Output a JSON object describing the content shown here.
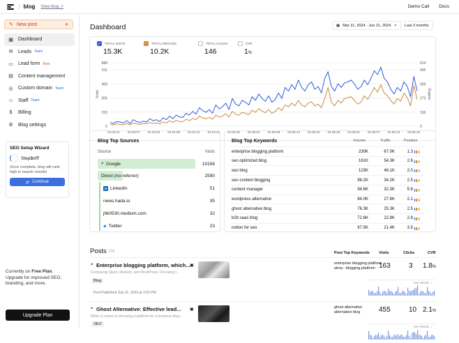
{
  "topbar": {
    "brand": "blog",
    "view_blog": "View blog",
    "demo_call": "Demo Call",
    "docs": "Docs"
  },
  "sidebar": {
    "new_post": "New post",
    "items": [
      {
        "label": "Dashboard",
        "icon": "dashboard-icon",
        "glyph": "▦",
        "tag": "",
        "active": true
      },
      {
        "label": "Leads",
        "icon": "leads-icon",
        "glyph": "✉",
        "tag": "Team"
      },
      {
        "label": "Lead form",
        "icon": "form-icon",
        "glyph": "▭",
        "tag": "New"
      },
      {
        "label": "Content management",
        "icon": "content-icon",
        "glyph": "▤",
        "tag": ""
      },
      {
        "label": "Custom domain",
        "icon": "globe-icon",
        "glyph": "◎",
        "tag": "Team"
      },
      {
        "label": "Staff",
        "icon": "staff-icon",
        "glyph": "☺",
        "tag": "Team"
      },
      {
        "label": "Billing",
        "icon": "billing-icon",
        "glyph": "$",
        "tag": ""
      },
      {
        "label": "Blog settings",
        "icon": "gear-icon",
        "glyph": "⚙",
        "tag": ""
      }
    ],
    "seo_wizard": {
      "title": "SEO Setup Wizard",
      "step_prefix": "Step ",
      "step": "3",
      "of": " of ",
      "total": "7",
      "desc": "Once complete, blog will rank high in search results!",
      "button": "Continue"
    },
    "plan": {
      "prefix": "Currently on ",
      "plan": "Free Plan",
      "suffix": ". Upgrade for improved SEO, branding, and more.",
      "button": "Upgrade Plan"
    }
  },
  "dashboard": {
    "title": "Dashboard",
    "date_range": "Mar 21, 2024 - Jun 21, 2024",
    "period": "Last 3 months",
    "stats": [
      {
        "label": "Total visits",
        "value": "15.3K",
        "color": "#2f5bd6",
        "checked": true
      },
      {
        "label": "Total organic",
        "value": "10.2K",
        "color": "#c98a3d",
        "checked": true
      },
      {
        "label": "Total clicks",
        "value": "146",
        "color": "#ffffff",
        "checked": false
      },
      {
        "label": "CVR",
        "value": "1",
        "unit": "%",
        "checked": false
      }
    ]
  },
  "chart_data": {
    "type": "line",
    "x": [
      "24.03.21",
      "24.03.27",
      "24.04.02",
      "24.04.08",
      "24.04.14",
      "24.04.20",
      "24.04.26",
      "24.05.02",
      "24.05.08",
      "24.05.14",
      "24.05.20",
      "24.05.26",
      "24.06.01",
      "24.06.07",
      "24.06.13",
      "24.06.19"
    ],
    "y_left_ticks": [
      0,
      153,
      306,
      458,
      611
    ],
    "y_left_labels": [
      "0",
      "153",
      "306",
      "458",
      "611"
    ],
    "y_right_labels": [
      "0",
      "136",
      "273",
      "409",
      "545"
    ],
    "y_left_top_label": "688",
    "y_right_top_label": "614",
    "ylim": [
      0,
      688
    ],
    "ylabel_left": "Visits",
    "ylabel_right": "Organic",
    "grid": true,
    "series": [
      {
        "color": "#2f5bd6",
        "values": [
          40,
          30,
          50,
          45,
          35,
          60,
          30,
          70,
          50,
          40,
          55,
          45,
          80,
          60,
          70,
          50,
          90,
          70,
          110,
          80,
          120,
          100,
          95,
          140,
          120,
          160,
          130,
          200,
          170,
          150,
          180,
          140,
          230,
          190,
          210,
          250,
          180,
          300,
          240,
          220,
          280,
          260,
          230,
          320,
          280,
          350,
          300,
          270,
          330,
          260,
          290,
          360,
          300,
          420,
          380,
          450,
          400,
          500,
          420,
          380,
          450,
          480,
          400,
          430,
          360,
          520,
          590,
          430,
          380,
          460,
          420,
          470,
          480,
          500,
          460,
          400,
          430,
          500,
          450,
          520,
          600,
          560,
          640,
          520,
          480,
          400,
          350,
          420,
          380,
          480,
          430,
          320,
          540,
          380
        ]
      },
      {
        "color": "#c98a3d",
        "values": [
          20,
          15,
          25,
          20,
          15,
          30,
          15,
          35,
          25,
          20,
          30,
          25,
          40,
          30,
          35,
          25,
          45,
          35,
          60,
          40,
          65,
          50,
          50,
          75,
          60,
          85,
          70,
          110,
          90,
          80,
          95,
          75,
          120,
          100,
          110,
          135,
          100,
          160,
          130,
          120,
          150,
          140,
          125,
          175,
          150,
          190,
          165,
          145,
          180,
          140,
          160,
          200,
          170,
          230,
          210,
          250,
          220,
          280,
          230,
          210,
          250,
          265,
          220,
          240,
          200,
          300,
          420,
          260,
          220,
          280,
          250,
          300,
          310,
          320,
          280,
          240,
          260,
          330,
          290,
          350,
          420,
          370,
          450,
          360,
          330,
          280,
          240,
          300,
          270,
          360,
          310,
          220,
          440,
          290
        ]
      }
    ]
  },
  "sources": {
    "title": "Blog Top Sources",
    "col_source": "Source",
    "col_visits": "Visits",
    "rows": [
      {
        "name": "Google",
        "count": "10156",
        "bar": 1.0,
        "icon": "search-icon",
        "glyph": "⌕"
      },
      {
        "name": "Direct (no-referrer)",
        "count": "2590",
        "bar": 0.255,
        "icon": "",
        "glyph": ""
      },
      {
        "name": "LinkedIn",
        "count": "51",
        "bar": 0,
        "icon": "linkedin-icon",
        "glyph": "in"
      },
      {
        "name": "news.hada.io",
        "count": "35",
        "bar": 0,
        "icon": "",
        "glyph": ""
      },
      {
        "name": "jhk0530.medium.com",
        "count": "32",
        "bar": 0,
        "icon": "",
        "glyph": ""
      },
      {
        "name": "Twitter",
        "count": "23",
        "bar": 0,
        "icon": "twitter-icon",
        "glyph": "🐦"
      }
    ]
  },
  "keywords": {
    "title": "Blog Top Keywords",
    "col_volume": "Volume",
    "col_traffic": "Traffic",
    "col_position": "Position",
    "rows": [
      {
        "kw": "enterprise blogging platform",
        "volume": "230K",
        "traffic": "67.0K",
        "position": "1.3"
      },
      {
        "kw": "seo optimized blog",
        "volume": "161K",
        "traffic": "54.3K",
        "position": "2.6"
      },
      {
        "kw": "seo blog",
        "volume": "123K",
        "traffic": "48.1K",
        "position": "2.0"
      },
      {
        "kw": "seo content blogging",
        "volume": "98.2K",
        "traffic": "34.2K",
        "position": "2.5"
      },
      {
        "kw": "content manager",
        "volume": "94.6K",
        "traffic": "32.3K",
        "position": "5.6"
      },
      {
        "kw": "wordpress alternative",
        "volume": "84.0K",
        "traffic": "27.6K",
        "position": "2.1"
      },
      {
        "kw": "ghost alternative blog",
        "volume": "76.3K",
        "traffic": "25.3K",
        "position": "2.5"
      },
      {
        "kw": "b2b saas blog",
        "volume": "72.6K",
        "traffic": "22.8K",
        "position": "2.8"
      },
      {
        "kw": "notion for seo",
        "volume": "67.5K",
        "traffic": "21.4K",
        "position": "3.5"
      }
    ]
  },
  "posts": {
    "title": "Posts",
    "count": "279",
    "col_keywords": "Post Top Keywords",
    "col_visits": "Visits",
    "col_clicks": "Clicks",
    "col_cvr": "CVR",
    "items": [
      {
        "title": "Enterprise blogging platform, which...",
        "desc": "Comparing Slash, Medium, and WordPress: Choosing t...",
        "tag": "Blog",
        "meta": "Post Published   July 11, 2023 at 2:52 PM",
        "kw1": "enterprise blogging platform",
        "kw2": "alma - blogging platform",
        "visits": "163",
        "clicks": "3",
        "cvr": "1.8",
        "unit": "%",
        "details": "See details"
      },
      {
        "title": "Ghost Alternative: Effective lead...",
        "desc": "When it comes to choosing a platform for a business blog...",
        "tag": "SEO",
        "meta": "",
        "kw1": "ghost alternative",
        "kw2": "alternative blog",
        "visits": "455",
        "clicks": "10",
        "cvr": "2.1",
        "unit": "%",
        "details": "See details"
      }
    ]
  }
}
